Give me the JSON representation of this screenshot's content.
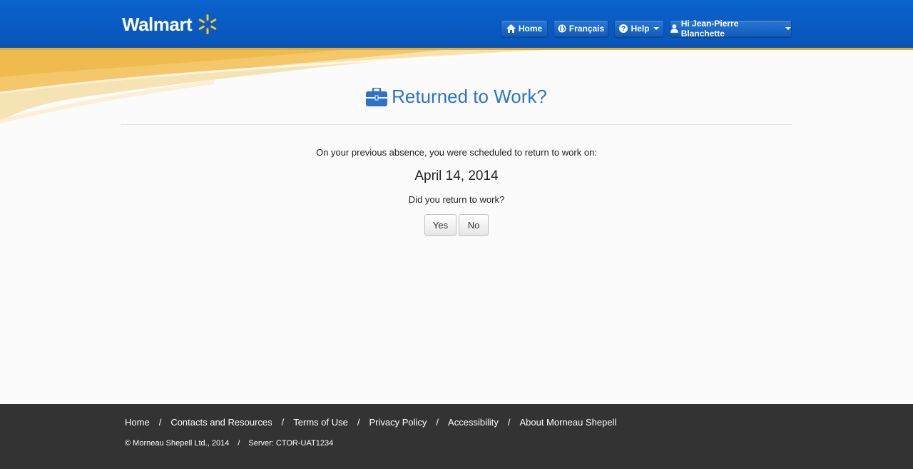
{
  "brand": {
    "name": "Walmart",
    "spark_color": "#ffc220",
    "header_color": "#0754b8"
  },
  "nav": {
    "home": "Home",
    "language": "Français",
    "help": "Help",
    "user": "Hi Jean-Pierre Blanchette"
  },
  "page": {
    "title": "Returned to Work?",
    "lead": "On your previous absence, you were scheduled to return to work on:",
    "date": "April 14, 2014",
    "question": "Did you return to work?",
    "yes_label": "Yes",
    "no_label": "No",
    "accent_color": "#2a73c8"
  },
  "footer": {
    "links": [
      "Home",
      "Contacts and Resources",
      "Terms of Use",
      "Privacy Policy",
      "Accessibility",
      "About Morneau Shepell"
    ],
    "copyright": "© Morneau Shepell Ltd., 2014",
    "server": "Server: CTOR-UAT1234"
  }
}
